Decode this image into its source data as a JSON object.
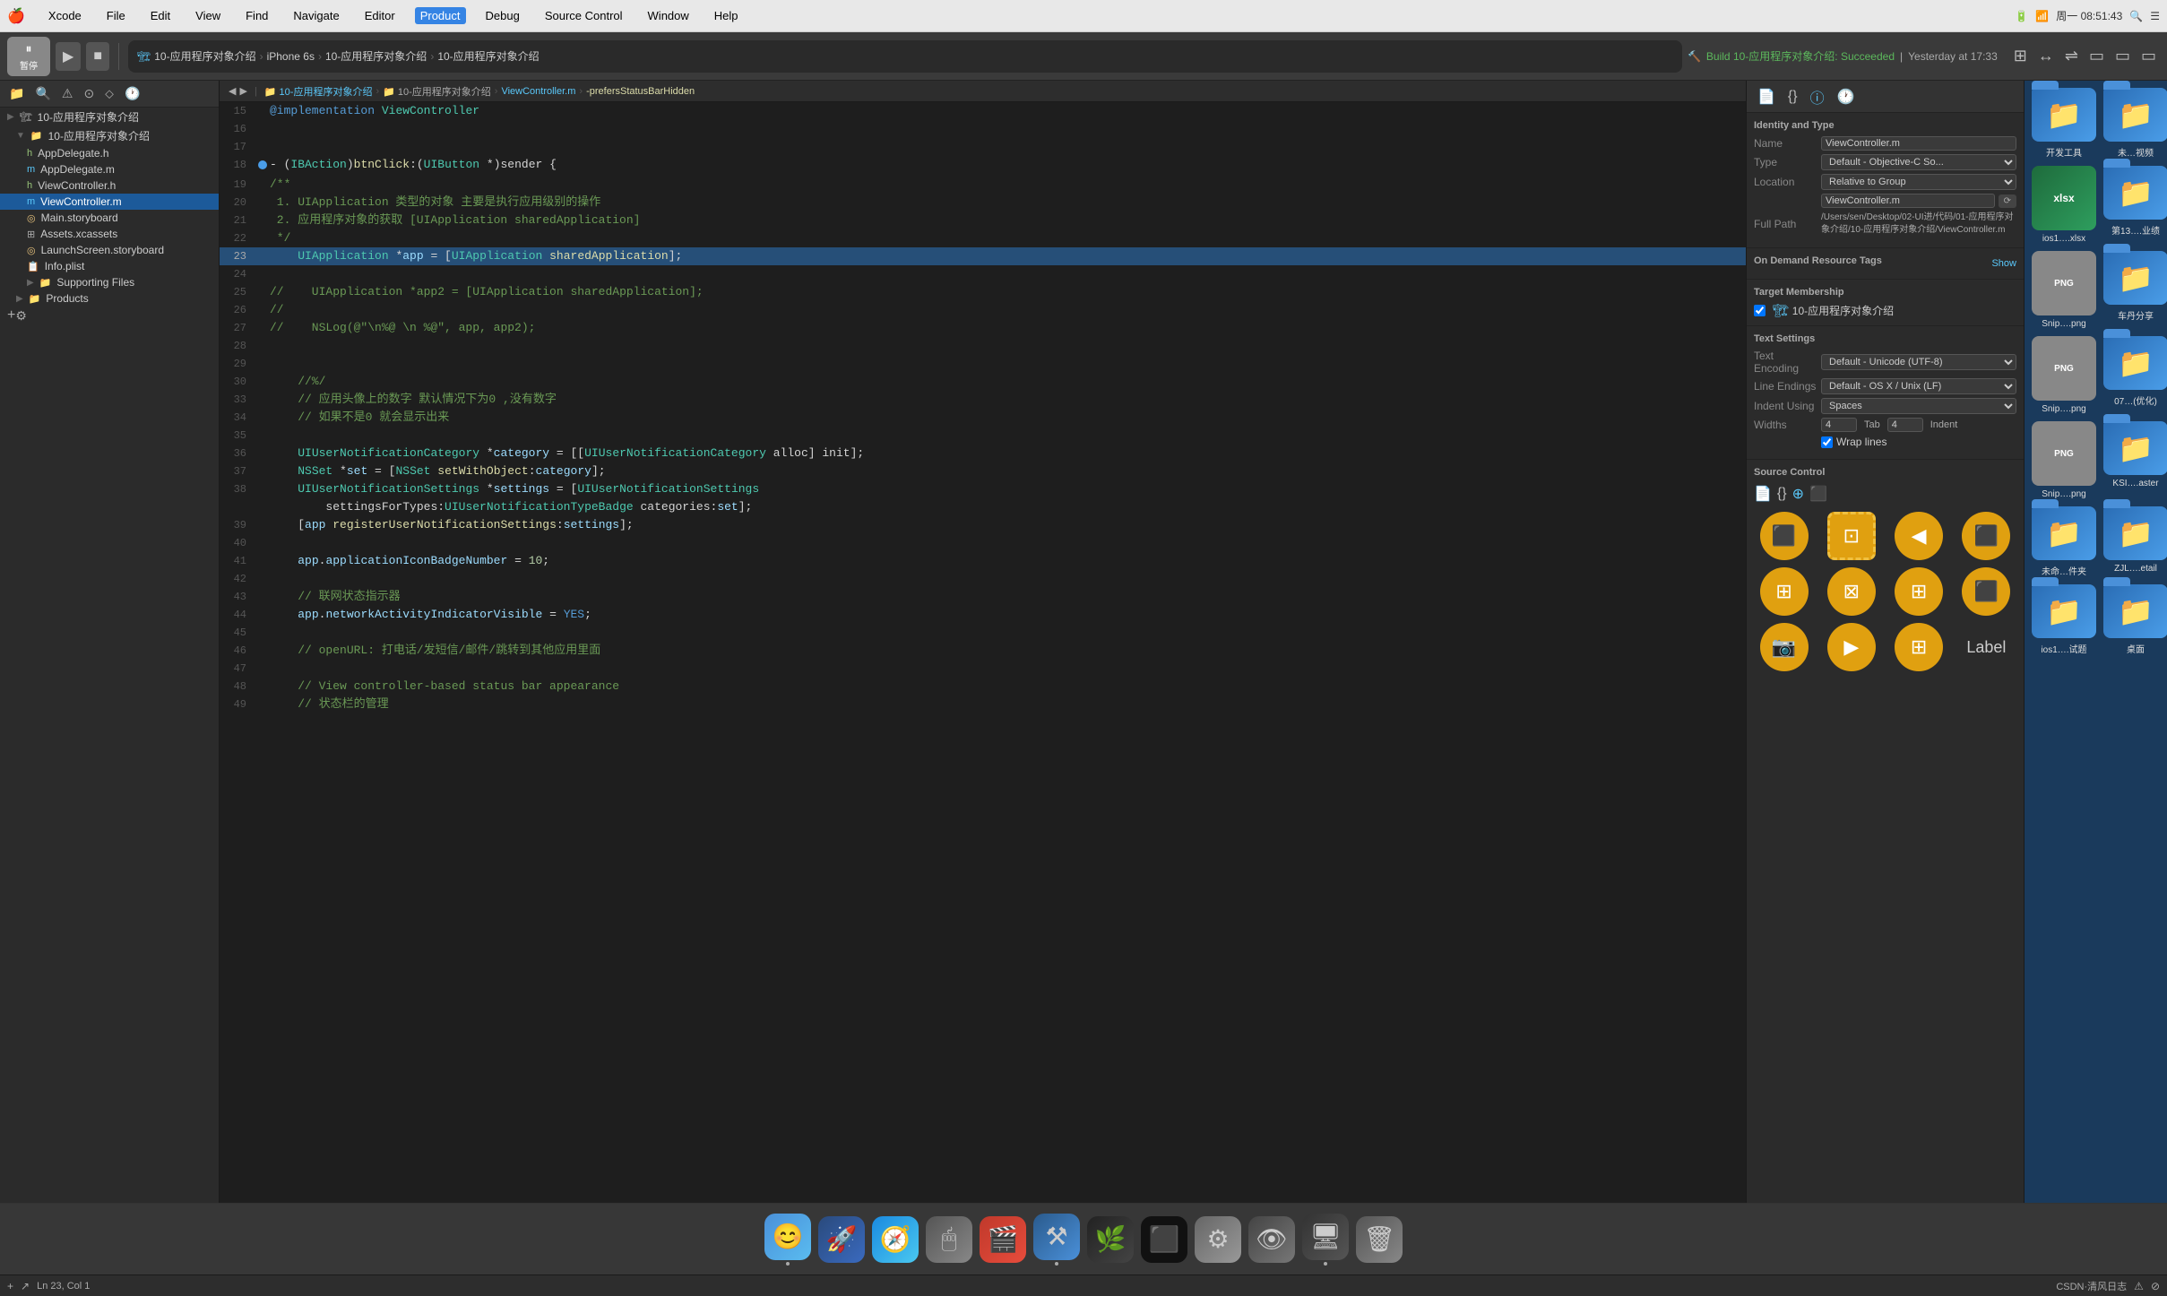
{
  "menubar": {
    "apple": "⌘",
    "items": [
      "Xcode",
      "File",
      "Edit",
      "View",
      "Find",
      "Navigate",
      "Editor",
      "Product",
      "Debug",
      "Source Control",
      "Window",
      "Help"
    ],
    "right": {
      "run_status": "",
      "time": "周一 08:51:43",
      "search": "🔍",
      "menu_icon": "≡"
    }
  },
  "toolbar": {
    "pause_label": "暂停",
    "run_btn": "▶",
    "stop_btn": "■",
    "app_label": "10-应用程序对象介绍",
    "device": "iPhone 6s",
    "project_name": "10-应用程序对象介绍",
    "project_name2": "10-应用程序对象介绍",
    "build_status": "Build 10-应用程序对象介绍: Succeeded",
    "build_time": "Yesterday at 17:33"
  },
  "breadcrumb": {
    "items": [
      "10-应用程序对象介绍",
      "ViewController.m",
      "-prefersStatusBarHidden"
    ]
  },
  "sidebar": {
    "title": "10-应用程序对象介绍",
    "items": [
      {
        "label": "10-应用程序对象介绍",
        "indent": 0,
        "type": "project",
        "expanded": true
      },
      {
        "label": "10-应用程序对象介绍",
        "indent": 1,
        "type": "folder",
        "expanded": true
      },
      {
        "label": "AppDelegate.h",
        "indent": 2,
        "type": "h"
      },
      {
        "label": "AppDelegate.m",
        "indent": 2,
        "type": "m"
      },
      {
        "label": "ViewController.h",
        "indent": 2,
        "type": "h"
      },
      {
        "label": "ViewController.m",
        "indent": 2,
        "type": "m",
        "selected": true
      },
      {
        "label": "Main.storyboard",
        "indent": 2,
        "type": "storyboard"
      },
      {
        "label": "Assets.xcassets",
        "indent": 2,
        "type": "assets"
      },
      {
        "label": "LaunchScreen.storyboard",
        "indent": 2,
        "type": "storyboard"
      },
      {
        "label": "Info.plist",
        "indent": 2,
        "type": "plist"
      },
      {
        "label": "Supporting Files",
        "indent": 2,
        "type": "folder"
      },
      {
        "label": "Products",
        "indent": 1,
        "type": "folder"
      }
    ]
  },
  "code": {
    "lines": [
      {
        "num": 15,
        "content": "@implementation ViewController",
        "type": "code"
      },
      {
        "num": 16,
        "content": "",
        "type": "empty"
      },
      {
        "num": 17,
        "content": "",
        "type": "empty"
      },
      {
        "num": 18,
        "content": "- (IBAction)btnClick:(UIButton *)sender {",
        "type": "code"
      },
      {
        "num": 19,
        "content": "/**",
        "type": "comment"
      },
      {
        "num": 20,
        "content": " 1. UIApplication 类型的对象 主要是执行应用级别的操作",
        "type": "comment"
      },
      {
        "num": 21,
        "content": " 2. 应用程序对象的获取 [UIApplication sharedApplication]",
        "type": "comment"
      },
      {
        "num": 22,
        "content": " */",
        "type": "comment"
      },
      {
        "num": 23,
        "content": "    UIApplication *app = [UIApplication sharedApplication];",
        "type": "code",
        "selected": true
      },
      {
        "num": 24,
        "content": "",
        "type": "empty"
      },
      {
        "num": 25,
        "content": "//    UIApplication *app2 = [UIApplication sharedApplication];",
        "type": "comment"
      },
      {
        "num": 26,
        "content": "//",
        "type": "comment"
      },
      {
        "num": 27,
        "content": "//    NSLog(@\"\\n%@ \\n %@\", app, app2);",
        "type": "comment"
      },
      {
        "num": 28,
        "content": "",
        "type": "empty"
      },
      {
        "num": 29,
        "content": "",
        "type": "empty"
      },
      {
        "num": 30,
        "content": "    //%/",
        "type": "comment"
      },
      {
        "num": 33,
        "content": "    // 应用头像上的数字 默认情况下为0 ,没有数字",
        "type": "comment"
      },
      {
        "num": 34,
        "content": "    // 如果不是0 就会显示出来",
        "type": "comment"
      },
      {
        "num": 35,
        "content": "",
        "type": "empty"
      },
      {
        "num": 36,
        "content": "    UIUserNotificationCategory *category = [[UIUserNotificationCategory alloc] init];",
        "type": "code"
      },
      {
        "num": 37,
        "content": "    NSSet *set = [NSSet setWithObject:category];",
        "type": "code"
      },
      {
        "num": 38,
        "content": "    UIUserNotificationSettings *settings = [UIUserNotificationSettings settingsForTypes:UIUserNotificationTypeBadge categories:set];",
        "type": "code"
      },
      {
        "num": 39,
        "content": "    [app registerUserNotificationSettings:settings];",
        "type": "code"
      },
      {
        "num": 40,
        "content": "",
        "type": "empty"
      },
      {
        "num": 41,
        "content": "    app.applicationIconBadgeNumber = 10;",
        "type": "code"
      },
      {
        "num": 42,
        "content": "",
        "type": "empty"
      },
      {
        "num": 43,
        "content": "    // 联网状态指示器",
        "type": "comment"
      },
      {
        "num": 44,
        "content": "    app.networkActivityIndicatorVisible = YES;",
        "type": "code"
      },
      {
        "num": 45,
        "content": "",
        "type": "empty"
      },
      {
        "num": 46,
        "content": "    // openURL: 打电话/发短信/邮件/跳转到其他应用里面",
        "type": "comment"
      },
      {
        "num": 47,
        "content": "",
        "type": "empty"
      },
      {
        "num": 48,
        "content": "    // View controller-based status bar appearance",
        "type": "comment"
      },
      {
        "num": 49,
        "content": "    // 状态栏的管理",
        "type": "comment"
      }
    ]
  },
  "right_panel": {
    "identity_type": {
      "title": "Identity and Type",
      "name_label": "Name",
      "name_value": "ViewController.m",
      "type_label": "Type",
      "type_value": "Default - Objective-C So...",
      "location_label": "Location",
      "location_value": "Relative to Group",
      "path_value": "ViewController.m",
      "full_path_label": "Full Path",
      "full_path_value": "/Users/sen/Desktop/02-UI进/代码/01-应用程序对象介绍/10-应用程序对象介绍/ViewController.m"
    },
    "on_demand": {
      "title": "On Demand Resource Tags",
      "show_label": "Show"
    },
    "target_membership": {
      "title": "Target Membership",
      "item": "10-应用程序对象介绍"
    },
    "text_settings": {
      "title": "Text Settings",
      "encoding_label": "Text Encoding",
      "encoding_value": "Default - Unicode (UTF-8)",
      "line_endings_label": "Line Endings",
      "line_endings_value": "Default - OS X / Unix (LF)",
      "indent_using_label": "Indent Using",
      "indent_using_value": "Spaces",
      "widths_label": "Widths",
      "tab_width": "4",
      "indent_width": "4",
      "tab_label": "Tab",
      "indent_label": "Indent",
      "wrap_lines_label": "Wrap lines"
    },
    "source_control": {
      "title": "Source Control"
    }
  },
  "desktop_files": [
    {
      "label": "开发工具",
      "color": "#2a6db5",
      "icon": "📁"
    },
    {
      "label": "未…视频",
      "color": "#2a6db5",
      "icon": "📁"
    },
    {
      "label": "ios1….xlsx",
      "color": "#1e6b3c",
      "icon": "📊"
    },
    {
      "label": "第13….业绩",
      "color": "#2a6db5",
      "icon": "📁"
    },
    {
      "label": "Snip….png",
      "color": "#888",
      "icon": "🖼"
    },
    {
      "label": "车丹分享",
      "color": "#2a6db5",
      "icon": "📁"
    },
    {
      "label": "Snip….png",
      "color": "#888",
      "icon": "🖼"
    },
    {
      "label": "07…(优化)",
      "color": "#2a6db5",
      "icon": "📁"
    },
    {
      "label": "Snip….png",
      "color": "#888",
      "icon": "🖼"
    },
    {
      "label": "KSI….aster",
      "color": "#2a6db5",
      "icon": "📁"
    },
    {
      "label": "未命…件夹",
      "color": "#2a6db5",
      "icon": "📁"
    },
    {
      "label": "ZJL….etail",
      "color": "#2a6db5",
      "icon": "📁"
    },
    {
      "label": "ios1….试题",
      "color": "#2a6db5",
      "icon": "📁"
    },
    {
      "label": "桌面",
      "color": "#2a6db5",
      "icon": "📁"
    }
  ],
  "dock": {
    "apps": [
      {
        "name": "Finder",
        "icon": "😊",
        "color": "#4a90d9"
      },
      {
        "name": "Launchpad",
        "icon": "🚀",
        "color": "#1a3a5c"
      },
      {
        "name": "Safari",
        "icon": "🧭",
        "color": "#1a6abf"
      },
      {
        "name": "Mouse",
        "icon": "🖱",
        "color": "#555"
      },
      {
        "name": "Screenflow",
        "icon": "🎬",
        "color": "#c0392b"
      },
      {
        "name": "Xcode",
        "icon": "⚒",
        "color": "#4a90d9"
      },
      {
        "name": "Git",
        "icon": "🌿",
        "color": "#333"
      },
      {
        "name": "Terminal",
        "icon": "⬛",
        "color": "#111"
      },
      {
        "name": "Settings",
        "icon": "⚙",
        "color": "#888"
      },
      {
        "name": "Looks",
        "icon": "👁",
        "color": "#555"
      },
      {
        "name": "Screen",
        "icon": "🖥",
        "color": "#444"
      },
      {
        "name": "Trash",
        "icon": "🗑",
        "color": "#666"
      }
    ]
  },
  "status_bar": {
    "left": "Ln 23, Col 1",
    "right": "CSDN·清风日志"
  }
}
